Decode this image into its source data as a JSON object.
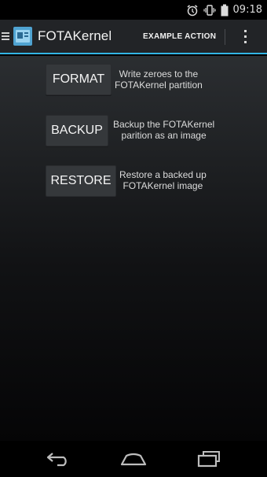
{
  "status_bar": {
    "time": "09:18",
    "icons": [
      "alarm-icon",
      "vibrate-icon",
      "battery-icon"
    ]
  },
  "action_bar": {
    "title": "FOTAKernel",
    "action_label": "EXAMPLE ACTION",
    "icons": [
      "up-icon",
      "app-icon",
      "overflow-menu-icon"
    ],
    "accent_color": "#33b5e5"
  },
  "operations": [
    {
      "button": "FORMAT",
      "description_line1": "Write zeroes to the",
      "description_line2": "FOTAKernel partition"
    },
    {
      "button": "BACKUP",
      "description_line1": "Backup the FOTAKernel",
      "description_line2": "parition as an image"
    },
    {
      "button": "RESTORE",
      "description_line1": "Restore a backed up",
      "description_line2": "FOTAKernel image"
    }
  ],
  "nav_bar": {
    "icons": [
      "back-icon",
      "home-icon",
      "recents-icon"
    ]
  }
}
